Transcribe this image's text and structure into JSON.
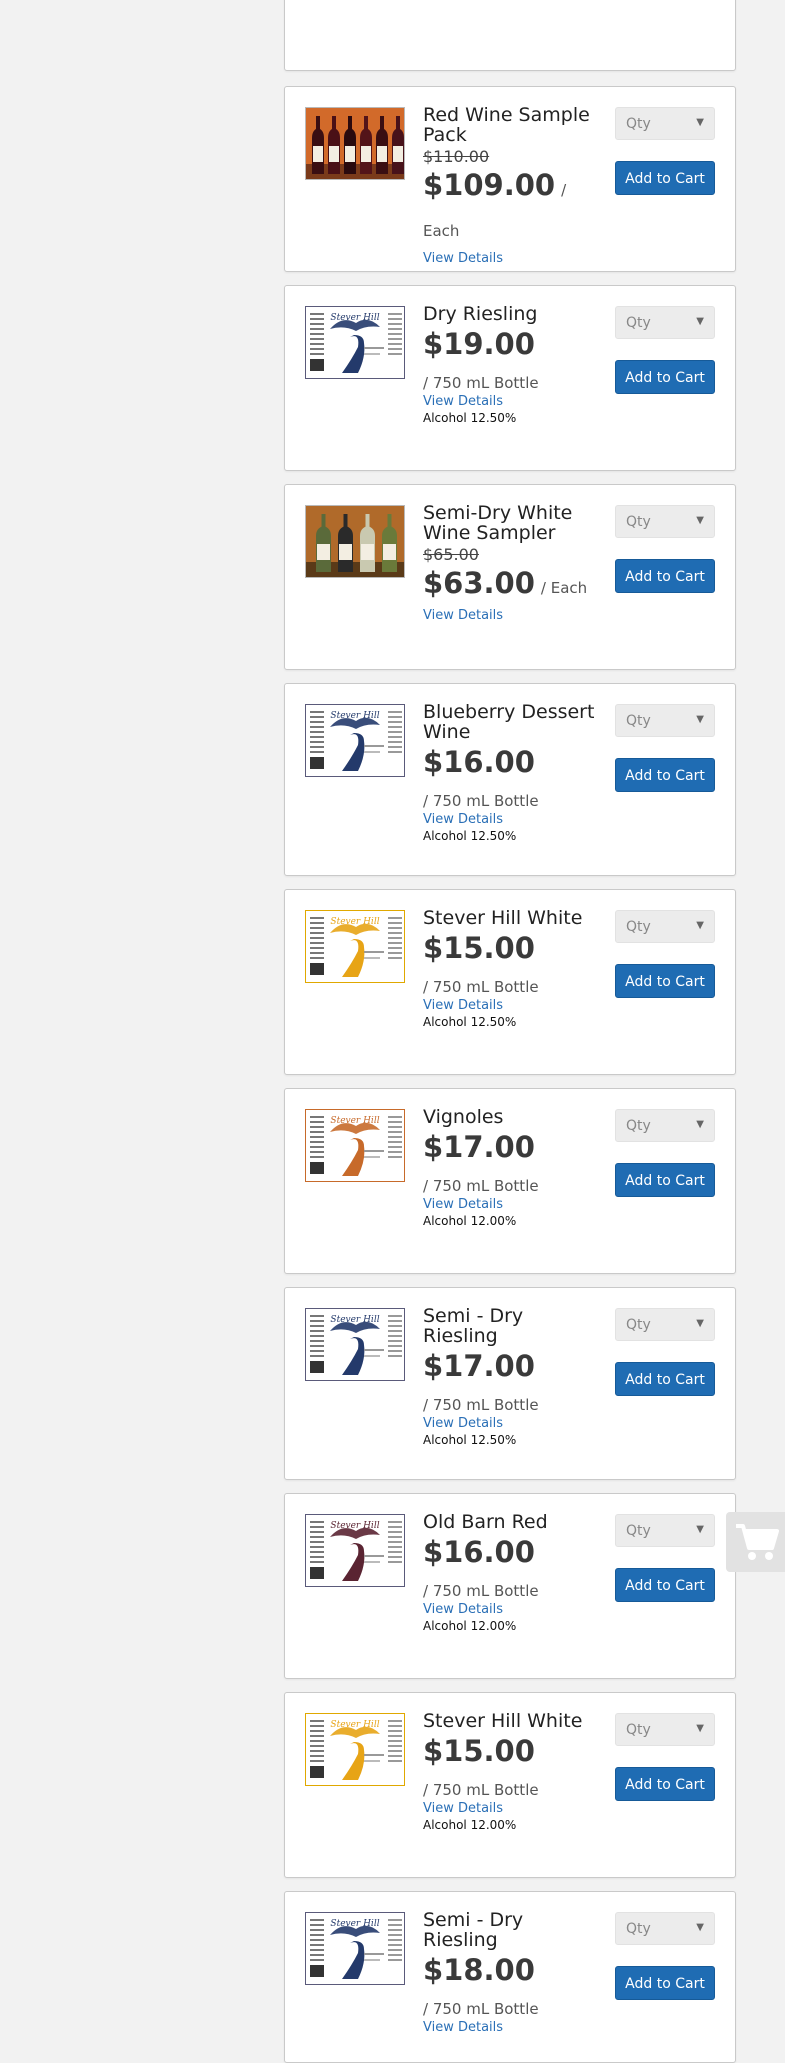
{
  "products": [
    {
      "name": "Red Wine Sample Pack",
      "old_price": "$110.00",
      "price": "$109.00",
      "unit": "/ Each",
      "details": "View Details",
      "alcohol": "",
      "qty": "Qty",
      "cart": "Add to Cart",
      "image": "red-wine-bottles-photo"
    },
    {
      "name": "Dry Riesling",
      "old_price": "",
      "price": "$19.00",
      "unit": "/ 750 mL Bottle",
      "details": "View Details",
      "alcohol": "Alcohol 12.50%",
      "qty": "Qty",
      "cart": "Add to Cart",
      "image": "wine-label-navy"
    },
    {
      "name": "Semi-Dry White Wine Sampler",
      "old_price": "$65.00",
      "price": "$63.00",
      "unit": "/ Each",
      "details": "View Details",
      "alcohol": "",
      "qty": "Qty",
      "cart": "Add to Cart",
      "image": "white-wine-bottles-photo"
    },
    {
      "name": "Blueberry Dessert Wine",
      "old_price": "",
      "price": "$16.00",
      "unit": "/ 750 mL Bottle",
      "details": "View Details",
      "alcohol": "Alcohol 12.50%",
      "qty": "Qty",
      "cart": "Add to Cart",
      "image": "wine-label-navy"
    },
    {
      "name": "Stever Hill White",
      "old_price": "",
      "price": "$15.00",
      "unit": "/ 750 mL Bottle",
      "details": "View Details",
      "alcohol": "Alcohol 12.50%",
      "qty": "Qty",
      "cart": "Add to Cart",
      "image": "wine-label-gold"
    },
    {
      "name": "Vignoles",
      "old_price": "",
      "price": "$17.00",
      "unit": "/ 750 mL Bottle",
      "details": "View Details",
      "alcohol": "Alcohol 12.00%",
      "qty": "Qty",
      "cart": "Add to Cart",
      "image": "wine-label-orange"
    },
    {
      "name": "Semi - Dry Riesling",
      "old_price": "",
      "price": "$17.00",
      "unit": "/ 750 mL Bottle",
      "details": "View Details",
      "alcohol": "Alcohol 12.50%",
      "qty": "Qty",
      "cart": "Add to Cart",
      "image": "wine-label-navy"
    },
    {
      "name": "Old Barn Red",
      "old_price": "",
      "price": "$16.00",
      "unit": "/ 750 mL Bottle",
      "details": "View Details",
      "alcohol": "Alcohol 12.00%",
      "qty": "Qty",
      "cart": "Add to Cart",
      "image": "wine-label-burgundy"
    },
    {
      "name": "Stever Hill White",
      "old_price": "",
      "price": "$15.00",
      "unit": "/ 750 mL Bottle",
      "details": "View Details",
      "alcohol": "Alcohol 12.00%",
      "qty": "Qty",
      "cart": "Add to Cart",
      "image": "wine-label-gold"
    },
    {
      "name": "Semi - Dry Riesling",
      "old_price": "",
      "price": "$18.00",
      "unit": "/ 750 mL Bottle",
      "details": "View Details",
      "alcohol": "",
      "qty": "Qty",
      "cart": "Add to Cart",
      "image": "wine-label-navy"
    }
  ],
  "mini_cart": {
    "count": "0",
    "icon": "shopping-cart-icon"
  },
  "colors": {
    "accent": "#1f6cb3",
    "link": "#2a6fb6",
    "background": "#f2f2f2"
  }
}
